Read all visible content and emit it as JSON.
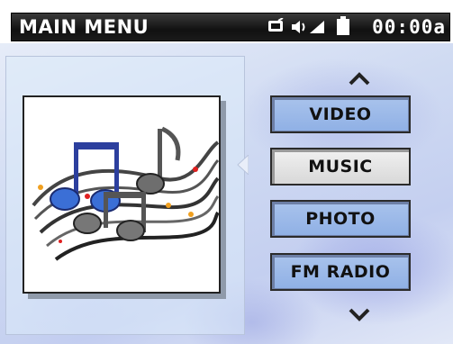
{
  "header": {
    "title": "MAIN MENU",
    "clock": "00:00a",
    "icons": [
      "tv-output-icon",
      "volume-icon",
      "signal-icon",
      "battery-icon"
    ]
  },
  "preview": {
    "icon": "music-notes-icon"
  },
  "menu": {
    "scroll_up_icon": "chevron-up-icon",
    "scroll_down_icon": "chevron-down-icon",
    "items": [
      {
        "label": "VIDEO",
        "selected": false
      },
      {
        "label": "MUSIC",
        "selected": true
      },
      {
        "label": "PHOTO",
        "selected": false
      },
      {
        "label": "FM RADIO",
        "selected": false
      }
    ]
  },
  "colors": {
    "item_normal": "#9bb8e9",
    "item_selected": "#e6e6e6",
    "titlebar": "#111111",
    "background": "#cfdaf2"
  }
}
